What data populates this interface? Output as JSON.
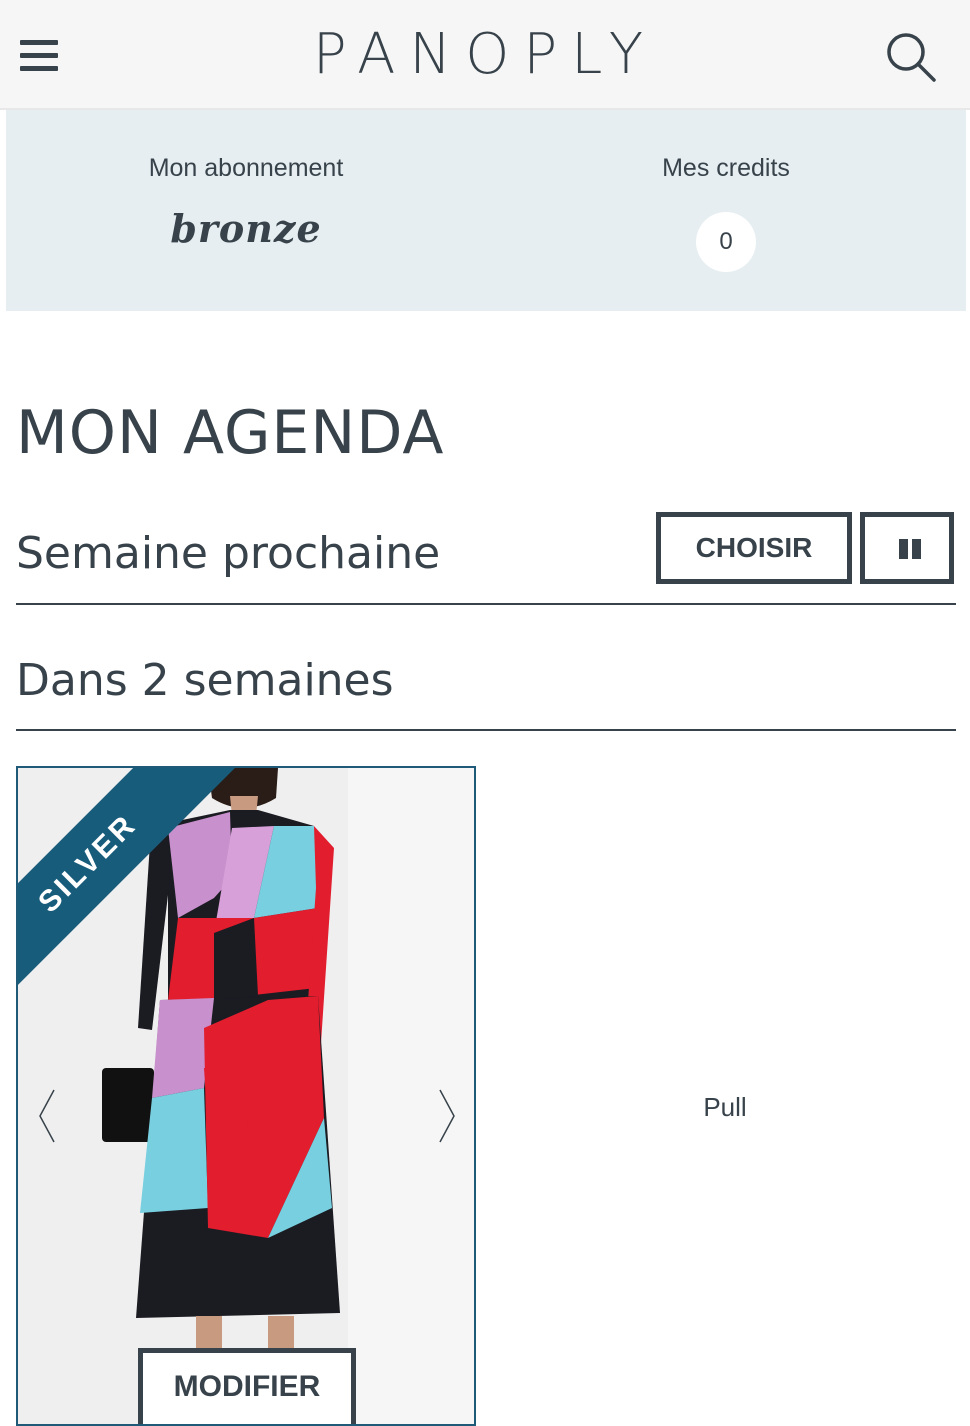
{
  "header": {
    "brand": "PANOPLY",
    "menu_icon": "hamburger-menu-icon",
    "search_icon": "search-icon"
  },
  "account": {
    "subscription_label": "Mon abonnement",
    "subscription_plan": "bronze",
    "credits_label": "Mes credits",
    "credits_value": "0"
  },
  "agenda": {
    "title": "MON AGENDA",
    "weeks": [
      {
        "label": "Semaine prochaine",
        "choose_label": "CHOISIR",
        "pause_icon": "pause-icon"
      },
      {
        "label": "Dans 2 semaines"
      }
    ],
    "item": {
      "tier_badge": "SILVER",
      "name": "Pull",
      "modify_label": "MODIFIER",
      "prev_icon": "chevron-left-icon",
      "next_icon": "chevron-right-icon"
    }
  },
  "colors": {
    "text": "#37424a",
    "account_bg": "#e6eef1",
    "badge": "#185c7c",
    "topbar_bg": "#f6f6f6"
  }
}
